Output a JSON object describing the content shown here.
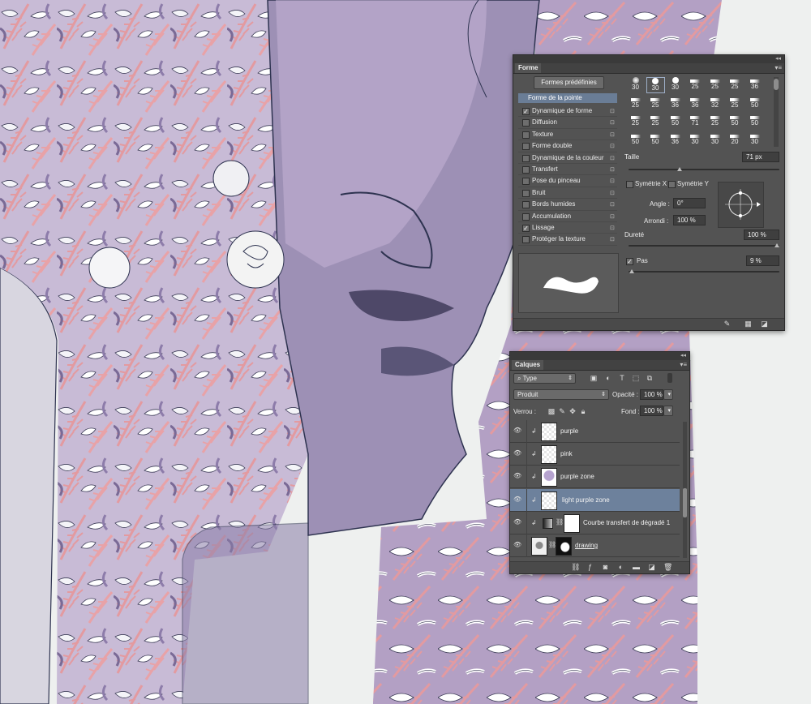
{
  "brush_panel": {
    "tab": "Forme",
    "presets_button": "Formes prédéfinies",
    "tip_shape": "Forme de la pointe",
    "options": [
      {
        "label": "Dynamique de forme",
        "checked": true
      },
      {
        "label": "Diffusion",
        "checked": false
      },
      {
        "label": "Texture",
        "checked": false
      },
      {
        "label": "Forme double",
        "checked": false
      },
      {
        "label": "Dynamique de la couleur",
        "checked": false
      },
      {
        "label": "Transfert",
        "checked": false
      },
      {
        "label": "Pose du pinceau",
        "checked": false
      },
      {
        "label": "Bruit",
        "checked": false
      },
      {
        "label": "Bords humides",
        "checked": false
      },
      {
        "label": "Accumulation",
        "checked": false
      },
      {
        "label": "Lissage",
        "checked": true
      },
      {
        "label": "Protéger la texture",
        "checked": false
      }
    ],
    "brush_sizes": [
      [
        "30",
        "30",
        "30",
        "25",
        "25",
        "25",
        "36"
      ],
      [
        "25",
        "25",
        "36",
        "36",
        "32",
        "25",
        "50"
      ],
      [
        "25",
        "25",
        "50",
        "71",
        "25",
        "50",
        "50"
      ],
      [
        "50",
        "50",
        "36",
        "30",
        "30",
        "20",
        "30"
      ]
    ],
    "size_label": "Taille",
    "size_value": "71 px",
    "flip_x_label": "Symétrie X",
    "flip_y_label": "Symétrie Y",
    "angle_label": "Angle :",
    "angle_value": "0°",
    "roundness_label": "Arrondi :",
    "roundness_value": "100 %",
    "hardness_label": "Dureté",
    "hardness_value": "100 %",
    "spacing_label": "Pas",
    "spacing_checked": true,
    "spacing_value": "9 %",
    "colors": {
      "panel": "#535353",
      "selection": "#6a7d96"
    }
  },
  "layers_panel": {
    "tab": "Calques",
    "filter_value": "Type",
    "blend_mode": "Produit",
    "opacity_label": "Opacité :",
    "opacity_value": "100 %",
    "lock_label": "Verrou :",
    "fill_label": "Fond :",
    "fill_value": "100 %",
    "layers": [
      {
        "name": "purple",
        "selected": false
      },
      {
        "name": "pink",
        "selected": false
      },
      {
        "name": "purple zone",
        "selected": false
      },
      {
        "name": "light purple zone",
        "selected": true
      },
      {
        "name": "Courbe transfert de dégradé 1",
        "selected": false
      },
      {
        "name": "drawing",
        "selected": false
      }
    ],
    "colors": {
      "selection": "#6d819c"
    }
  },
  "artwork": {
    "colors": {
      "purple": "#5a5577",
      "lilac": "#b9a6c9",
      "pink": "#e39aa0",
      "paper": "#eef0ef",
      "ink": "#2e3350"
    }
  }
}
